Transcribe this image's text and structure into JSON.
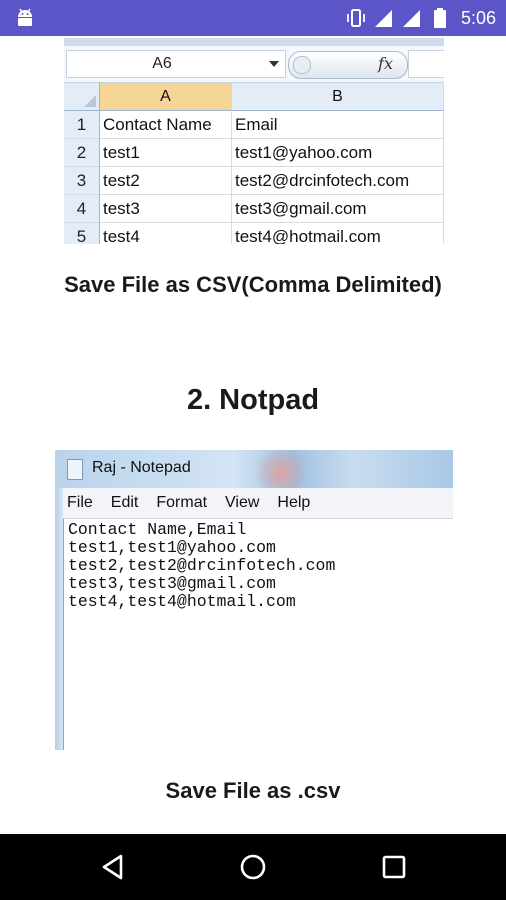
{
  "status_bar": {
    "time": "5:06",
    "background": "#5b55c8",
    "icons": [
      "android-icon",
      "vibrate-icon",
      "signal-icon",
      "signal-icon",
      "battery-icon"
    ]
  },
  "excel_image": {
    "name_box": "A6",
    "fx_label": "fx",
    "column_headers": [
      "A",
      "B"
    ],
    "rows": [
      {
        "num": "1",
        "a": "Contact Name",
        "b": "Email"
      },
      {
        "num": "2",
        "a": "test1",
        "b": "test1@yahoo.com"
      },
      {
        "num": "3",
        "a": "test2",
        "b": "test2@drcinfotech.com"
      },
      {
        "num": "4",
        "a": "test3",
        "b": "test3@gmail.com"
      },
      {
        "num": "5",
        "a": "test4",
        "b": "test4@hotmail.com"
      }
    ]
  },
  "caption_1": "Save File as CSV(Comma Delimited)",
  "heading_2": "2. Notpad",
  "notepad_image": {
    "title": "Raj - Notepad",
    "menu": [
      "File",
      "Edit",
      "Format",
      "View",
      "Help"
    ],
    "lines": [
      "Contact Name,Email",
      "test1,test1@yahoo.com",
      "test2,test2@drcinfotech.com",
      "test3,test3@gmail.com",
      "test4,test4@hotmail.com"
    ]
  },
  "caption_2": "Save File as .csv",
  "nav_bar": {
    "buttons": [
      "back-icon",
      "home-icon",
      "recents-icon"
    ]
  }
}
